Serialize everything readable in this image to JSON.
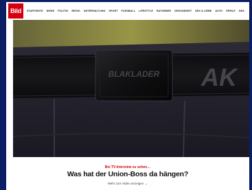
{
  "header": {
    "logo": "Bild",
    "nav": [
      "Startseite",
      "News",
      "Politik",
      "Regio",
      "Unterhaltung",
      "Sport",
      "Fussball",
      "Lifestyle",
      "Ratgeber",
      "Gesundheit",
      "Sex & Liebe",
      "Auto",
      "Spiele",
      "Dea"
    ]
  },
  "hero": {
    "buckle_text": "BLAKLADER",
    "strap_text": "AK"
  },
  "article": {
    "kicker": "Bei TV-Interview zu sehen…",
    "headline": "Was hat der Union-Boss da hängen?",
    "more_label": "Mehr zum Video anzeigen",
    "more_icon": "chevron-down-icon"
  },
  "colors": {
    "brand": "#d4000e",
    "background": "#0b1e63"
  }
}
